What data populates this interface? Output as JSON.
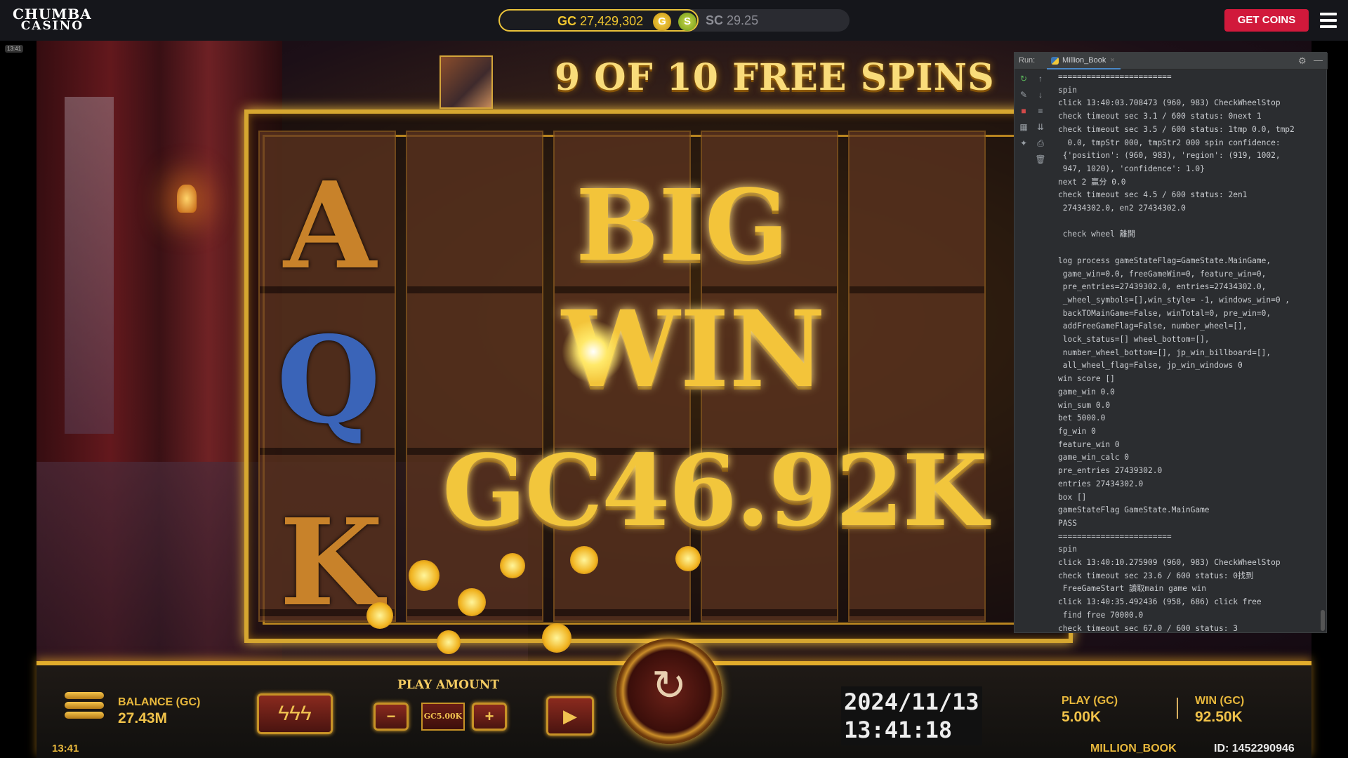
{
  "header": {
    "logo_line1": "CHUMBA",
    "logo_line2": "CASINO",
    "gc_label": "GC",
    "gc_value": "27,429,302",
    "gc_coin": "G",
    "sc_coin": "S",
    "sc_label": "SC",
    "sc_value": "29.25",
    "get_coins": "GET COINS",
    "corner_time": "13:41"
  },
  "game": {
    "free_spins_title": "9 OF 10 FREE SPINS",
    "big_text": "BIG",
    "win_text": "WIN",
    "win_amount": "GC46.92K",
    "symbols": [
      "A",
      "Q",
      "K"
    ]
  },
  "ide_panel": {
    "run_label": "Run:",
    "tab_name": "Million_Book",
    "log_lines": [
      "========================",
      "spin",
      "click 13:40:03.708473 (960, 983) CheckWheelStop",
      "check timeout sec 3.1 / 600 status: 0next 1",
      "check timeout sec 3.5 / 600 status: 1tmp 0.0, tmp2",
      "  0.0, tmpStr 000, tmpStr2 000 spin confidence:",
      " {'position': (960, 983), 'region': (919, 1002,",
      " 947, 1020), 'confidence': 1.0}",
      "next 2 贏分 0.0",
      "check timeout sec 4.5 / 600 status: 2en1",
      " 27434302.0, en2 27434302.0",
      "",
      " check wheel 離開",
      "",
      "log process gameStateFlag=GameState.MainGame,",
      " game_win=0.0, freeGameWin=0, feature_win=0,",
      " pre_entries=27439302.0, entries=27434302.0,",
      " _wheel_symbols=[],win_style= -1, windows_win=0 ,",
      " backTOMainGame=False, winTotal=0, pre_win=0,",
      " addFreeGameFlag=False, number_wheel=[],",
      " lock_status=[] wheel_bottom=[],",
      " number_wheel_bottom=[], jp_win_billboard=[],",
      " all_wheel_flag=False, jp_win_windows 0",
      "win score []",
      "game_win 0.0",
      "win_sum 0.0",
      "bet 5000.0",
      "fg_win 0",
      "feature_win 0",
      "game_win_calc 0",
      "pre_entries 27439302.0",
      "entries 27434302.0",
      "box []",
      "gameStateFlag GameState.MainGame",
      "PASS",
      "========================",
      "spin",
      "click 13:40:10.275909 (960, 983) CheckWheelStop",
      "check timeout sec 23.6 / 600 status: 0找到",
      " FreeGameStart 讀取main game win",
      "click 13:40:35.492436 (958, 686) click free",
      " find free 70000.0",
      "check timeout sec 67.0 / 600 status: 3"
    ]
  },
  "bottom": {
    "balance_label": "BALANCE (GC)",
    "balance_value": "27.43M",
    "clock": "13:41",
    "play_amount_label": "PLAY AMOUNT",
    "minus": "−",
    "bet_value": "GC5.00K",
    "plus": "+",
    "date_line": "2024/11/13",
    "time_line": "13:41:18",
    "play_label": "PLAY (GC)",
    "play_value": "5.00K",
    "win_label": "WIN (GC)",
    "win_value": "92.50K",
    "game_name": "MILLION_BOOK",
    "game_id": "ID: 1452290946"
  }
}
